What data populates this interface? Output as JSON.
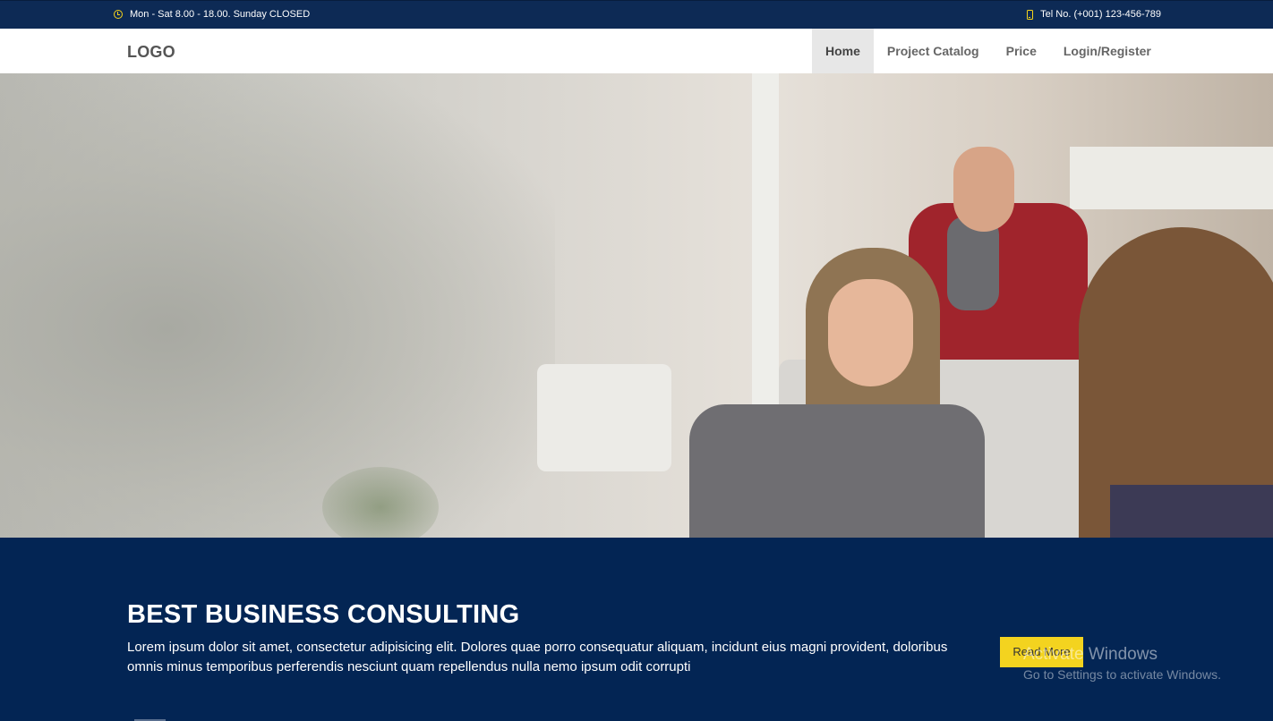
{
  "topbar": {
    "hours": "Mon - Sat 8.00 - 18.00. Sunday CLOSED",
    "tel": "Tel No. (+001) 123-456-789",
    "hours_icon": "clock-icon",
    "tel_icon": "phone-icon",
    "accent_color": "#f5d31a"
  },
  "navbar": {
    "logo": "LOGO",
    "items": [
      {
        "label": "Home",
        "active": true
      },
      {
        "label": "Project Catalog",
        "active": false
      },
      {
        "label": "Price",
        "active": false
      },
      {
        "label": "Login/Register",
        "active": false
      }
    ]
  },
  "hero": {
    "image": "office meeting photo"
  },
  "section": {
    "heading": "BEST BUSINESS CONSULTING",
    "text": "Lorem ipsum dolor sit amet, consectetur adipisicing elit. Dolores quae porro consequatur aliquam, incidunt eius magni provident, doloribus omnis minus temporibus perferendis nesciunt quam repellendus nulla nemo ipsum odit corrupti",
    "button": "Read More",
    "background": "#032554",
    "button_color": "#f3d31f"
  },
  "watermark": {
    "line1": "Activate Windows",
    "line2": "Go to Settings to activate Windows."
  }
}
